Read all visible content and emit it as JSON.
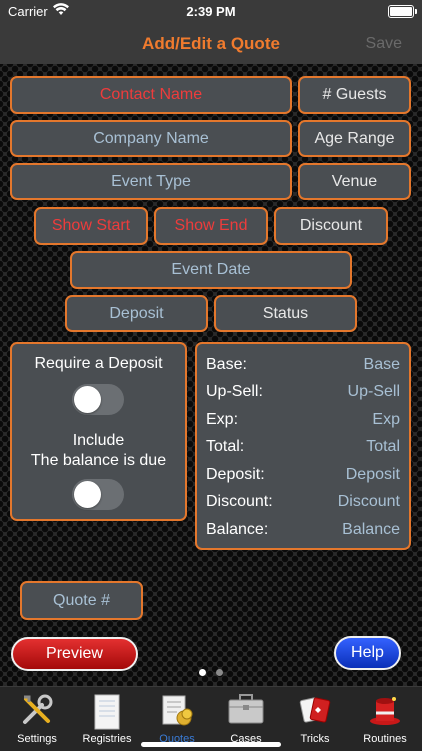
{
  "status_bar": {
    "carrier": "Carrier",
    "time": "2:39 PM"
  },
  "nav": {
    "title": "Add/Edit a Quote",
    "save": "Save"
  },
  "fields": {
    "contact_name": "Contact Name",
    "guests": "# Guests",
    "company_name": "Company Name",
    "age_range": "Age Range",
    "event_type": "Event Type",
    "venue": "Venue",
    "show_start": "Show Start",
    "show_end": "Show End",
    "discount": "Discount",
    "event_date": "Event Date",
    "deposit": "Deposit",
    "status": "Status",
    "quote_number": "Quote #"
  },
  "options": {
    "require_deposit": "Require a Deposit",
    "include_line1": "Include",
    "include_line2": "The balance is due",
    "require_deposit_on": false,
    "include_on": false
  },
  "summary": [
    {
      "label": "Base:",
      "value": "Base"
    },
    {
      "label": "Up-Sell:",
      "value": "Up-Sell"
    },
    {
      "label": "Exp:",
      "value": "Exp"
    },
    {
      "label": "Total:",
      "value": "Total"
    },
    {
      "label": "Deposit:",
      "value": "Deposit"
    },
    {
      "label": "Discount:",
      "value": "Discount"
    },
    {
      "label": "Balance:",
      "value": "Balance"
    }
  ],
  "buttons": {
    "preview": "Preview",
    "help": "Help"
  },
  "page_indicator": {
    "count": 2,
    "current": 0
  },
  "tabs": [
    {
      "label": "Settings",
      "icon": "tools-icon"
    },
    {
      "label": "Registries",
      "icon": "document-icon"
    },
    {
      "label": "Quotes",
      "icon": "quotes-icon",
      "active": true
    },
    {
      "label": "Cases",
      "icon": "briefcase-icon"
    },
    {
      "label": "Tricks",
      "icon": "playing-cards-icon"
    },
    {
      "label": "Routines",
      "icon": "magic-hat-icon"
    }
  ],
  "colors": {
    "accent": "#f07b2e",
    "border": "#e4772c",
    "field_bg": "#4a4e52",
    "placeholder": "#a8c0d4",
    "required": "#ee3c3c",
    "tab_active": "#3a7bd5"
  }
}
